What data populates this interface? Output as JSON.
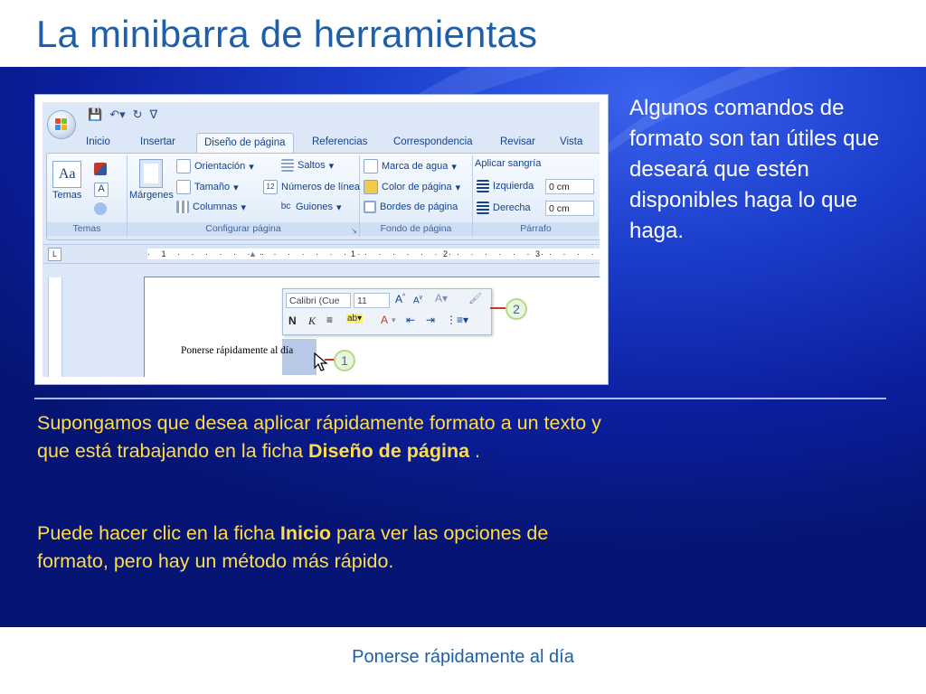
{
  "slide": {
    "title": "La minibarra de herramientas",
    "side_text": "Algunos comandos de formato son tan útiles que deseará que estén disponibles haga lo que haga.",
    "paragraph1": {
      "pre": "Supongamos que desea aplicar rápidamente formato a un texto y que está trabajando en la ficha ",
      "bold": "Diseño de página",
      "post": " ."
    },
    "paragraph2": {
      "pre": "Puede hacer clic en la ficha ",
      "bold": "Inicio",
      "post": " para ver las opciones de formato, pero hay un método más rápido."
    },
    "footer": "Ponerse rápidamente al día"
  },
  "screenshot": {
    "tabs": [
      "Inicio",
      "Insertar",
      "Diseño de página",
      "Referencias",
      "Correspondencia",
      "Revisar",
      "Vista"
    ],
    "active_tab": "Diseño de página",
    "groups": {
      "temas": {
        "label": "Temas",
        "button": "Temas"
      },
      "configurar": {
        "label": "Configurar página",
        "margenes": "Márgenes",
        "orientacion": "Orientación",
        "tamano": "Tamaño",
        "columnas": "Columnas",
        "saltos": "Saltos",
        "numeros_linea": "Números de línea",
        "guiones": "Guiones"
      },
      "fondo": {
        "label": "Fondo de página",
        "marca_agua": "Marca de agua",
        "color_pagina": "Color de página",
        "bordes_pagina": "Bordes de página"
      },
      "parrafo": {
        "label": "Párrafo",
        "aplicar_sangria": "Aplicar sangría",
        "izquierda": "Izquierda",
        "izquierda_value": "0 cm",
        "derecha": "Derecha",
        "derecha_value": "0 cm"
      }
    },
    "ruler_numbers": [
      "1",
      "1",
      "2",
      "3"
    ],
    "mini_toolbar": {
      "font": "Calibri (Cue",
      "size": "11"
    },
    "document_text": "Ponerse rápidamente al día",
    "callouts": [
      "1",
      "2"
    ]
  },
  "colors": {
    "title": "#1f5fa8",
    "band": "#1b3dcc",
    "body_text": "#ffdc4a",
    "side_text": "#ffffff"
  }
}
